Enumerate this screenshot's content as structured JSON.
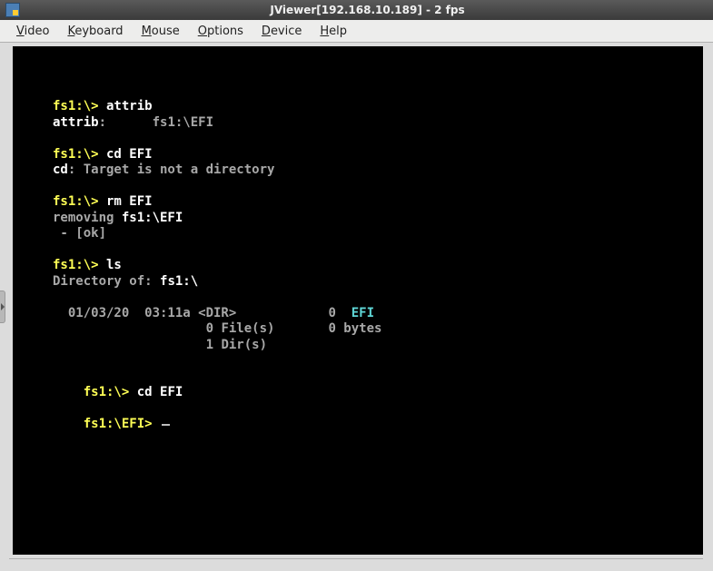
{
  "window": {
    "title": "JViewer[192.168.10.189] - 2 fps"
  },
  "menu": {
    "video": "Video",
    "keyboard": "Keyboard",
    "mouse": "Mouse",
    "options": "Options",
    "device": "Device",
    "help": "Help"
  },
  "terminal": {
    "l1_prompt": "fs1:\\>",
    "l1_cmd": " attrib",
    "l2_a": "attrib",
    "l2_b": ":      ",
    "l2_c": "fs1:\\EFI",
    "blank": "",
    "l4_prompt": "fs1:\\>",
    "l4_cmd": " cd EFI",
    "l5_a": "cd",
    "l5_b": ": Target is not a directory",
    "l7_prompt": "fs1:\\>",
    "l7_cmd": " rm EFI",
    "l8_a": "removing ",
    "l8_b": "fs1:\\EFI",
    "l9": " - [ok]",
    "l11_prompt": "fs1:\\>",
    "l11_cmd": " ls",
    "l12_a": "Directory of: ",
    "l12_b": "fs1:\\",
    "l14_a": "  01/03/20  03:11a <DIR>            ",
    "l14_b": "0",
    "l14_c": "  ",
    "l14_d": "EFI",
    "l15": "          0 File(s)       0 bytes",
    "l16": "          1 Dir(s)",
    "l19_indent": "    ",
    "l19_prompt": "fs1:\\>",
    "l19_cmd": " cd EFI",
    "l21_indent": "    ",
    "l21_prompt": "fs1:\\EFI> "
  }
}
